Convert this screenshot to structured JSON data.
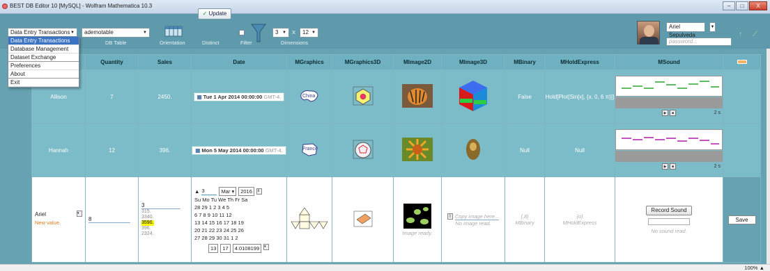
{
  "window": {
    "title": "BEST DB Editor 10 [MySQL] - Wolfram Mathematica 10.3",
    "min": "–",
    "max": "□",
    "close": "X"
  },
  "toolbar": {
    "mode_select": "Data Entry Transactions",
    "table_select": "ademotable",
    "db_table_label": "DB Table",
    "orientation_label": "Orientation",
    "update_label": "Update",
    "distinct_label": "Distinct",
    "filter_label": "Filter",
    "dim_rows": "3",
    "dim_x": "X",
    "dim_cols": "12",
    "dimensions_label": "Dimensions",
    "user_name": "Ariel Sepulveda",
    "password_placeholder": "password..."
  },
  "mode_menu": {
    "items": [
      "Data Entry Transactions",
      "Database Management",
      "Dataset Exchange",
      "Preferences",
      "About",
      "Exit"
    ]
  },
  "columns": [
    "Quantity",
    "Sales",
    "Date",
    "MGraphics",
    "MGraphics3D",
    "MImage2D",
    "MImage3D",
    "MBinary",
    "MHoldExpress",
    "MSound"
  ],
  "rows": [
    {
      "name": "Allison",
      "quantity": "7",
      "sales": "2450.",
      "date": "Tue 1 Apr 2014 00:00:00",
      "tz": "GMT-4.",
      "graphics_label": "China",
      "binary": "False",
      "hold": "Hold[Plot[Sin[x], {x, 0, 6 π}]]",
      "duration": "2 s"
    },
    {
      "name": "Hannah",
      "quantity": "12",
      "sales": "396.",
      "date": "Mon 5 May 2014 00:00:00",
      "tz": "GMT-4.",
      "graphics_label": "France",
      "binary": "Null",
      "hold": "Null",
      "duration": "2 s"
    }
  ],
  "edit_row": {
    "name": "Ariel",
    "new_value": "New value.",
    "quantity": "8",
    "sales_value": "3",
    "sales_list": [
      "315.",
      "3340.",
      "3590.",
      "396.",
      "2324."
    ],
    "cal_day": "3",
    "cal_month": "Mar",
    "cal_year": "2016",
    "cal_header": "Su Mo Tu We Th Fr Sa",
    "cal_weeks": [
      "28 29 1 2 3 4 5",
      "6 7 8 9 10 11 12",
      "13 14 15 16 17 18 19",
      "20 21 22 23 24 25 26",
      "27 28 29 30 31 1 2"
    ],
    "time_h": "13",
    "time_m": "17",
    "time_s": "4.0108199",
    "image_ready": "Image ready.",
    "copy_image": "Copy image here...",
    "no_image": "No image read.",
    "binary_braces": "{,8}",
    "binary_label": "MBinary",
    "hold_braces": "{o}",
    "hold_label": "MHoldExpress",
    "record_label": "Record Sound",
    "no_sound": "No sound read.",
    "save_label": "Save"
  },
  "status": {
    "zoom": "100%"
  }
}
